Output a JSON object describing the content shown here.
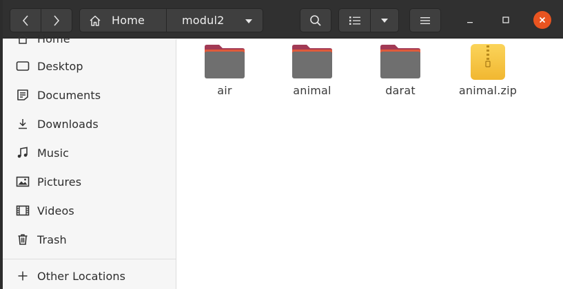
{
  "header": {
    "back_icon": "chevron-left-icon",
    "forward_icon": "chevron-right-icon",
    "breadcrumb": [
      {
        "label": "Home",
        "icon": "home-icon"
      },
      {
        "label": "modul2",
        "icon": "chevron-down-icon"
      }
    ],
    "search_icon": "search-icon",
    "view_icon": "list-view-icon",
    "menu_icon": "hamburger-menu-icon",
    "close_color": "#e95420"
  },
  "sidebar": {
    "items": [
      {
        "label": "Home",
        "icon": "home-icon"
      },
      {
        "label": "Desktop",
        "icon": "desktop-icon"
      },
      {
        "label": "Documents",
        "icon": "documents-icon"
      },
      {
        "label": "Downloads",
        "icon": "downloads-icon"
      },
      {
        "label": "Music",
        "icon": "music-icon"
      },
      {
        "label": "Pictures",
        "icon": "pictures-icon"
      },
      {
        "label": "Videos",
        "icon": "videos-icon"
      },
      {
        "label": "Trash",
        "icon": "trash-icon"
      }
    ],
    "other_locations": {
      "label": "Other Locations",
      "icon": "plus-icon"
    }
  },
  "files": [
    {
      "name": "air",
      "type": "folder"
    },
    {
      "name": "animal",
      "type": "folder"
    },
    {
      "name": "darat",
      "type": "folder"
    },
    {
      "name": "animal.zip",
      "type": "zip-archive"
    }
  ],
  "colors": {
    "folder_body": "#6f6f6f",
    "folder_tab": "#a23a55",
    "folder_accent": "#e05a3b",
    "zip": "#f6c443"
  }
}
